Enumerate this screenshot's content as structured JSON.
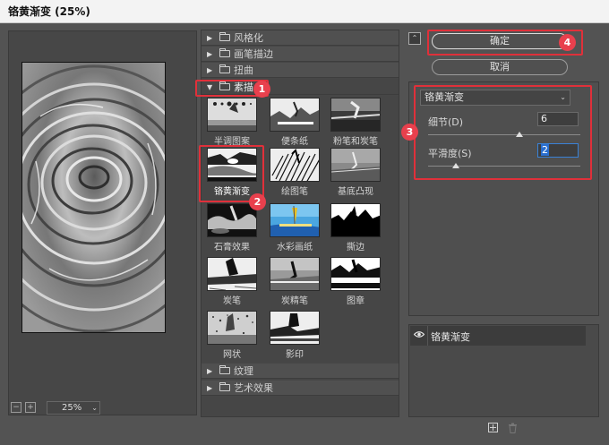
{
  "window": {
    "title": "铬黄渐变 (25%)"
  },
  "preview": {
    "zoom": "25%",
    "zoom_out_icon": "minus-square-icon",
    "zoom_in_icon": "plus-square-icon"
  },
  "categories_top": [
    {
      "label": "风格化",
      "expanded": false
    },
    {
      "label": "画笔描边",
      "expanded": false
    },
    {
      "label": "扭曲",
      "expanded": false
    },
    {
      "label": "素描",
      "expanded": true
    }
  ],
  "filters": [
    "半调图案",
    "便条纸",
    "粉笔和炭笔",
    "铬黄渐变",
    "绘图笔",
    "基底凸现",
    "石膏效果",
    "水彩画纸",
    "撕边",
    "炭笔",
    "炭精笔",
    "图章",
    "网状",
    "影印"
  ],
  "selected_filter": "铬黄渐变",
  "categories_bottom": [
    {
      "label": "纹理",
      "expanded": false
    },
    {
      "label": "艺术效果",
      "expanded": false
    }
  ],
  "buttons": {
    "ok": "确定",
    "cancel": "取消"
  },
  "settings": {
    "filter_select": "铬黄渐变",
    "params": [
      {
        "label": "细节(D)",
        "value": "6",
        "level": 0.6
      },
      {
        "label": "平滑度(S)",
        "value": "2",
        "level": 0.2
      }
    ]
  },
  "layers": [
    {
      "label": "铬黄渐变",
      "visible": true
    }
  ],
  "annotations": [
    "1",
    "2",
    "3",
    "4"
  ],
  "colors": {
    "highlight": "#e0303a",
    "badge": "#e8404d",
    "accent": "#2a6fd0"
  }
}
